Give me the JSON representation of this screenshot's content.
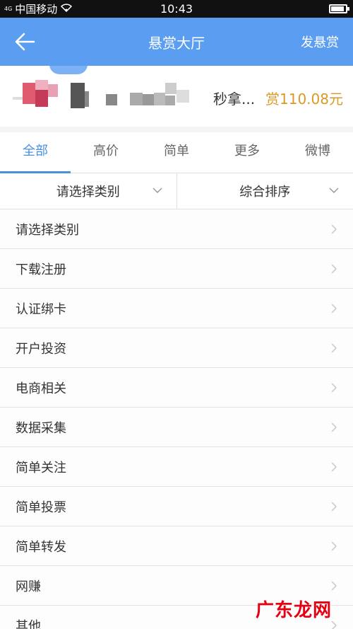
{
  "status_bar": {
    "signal": "4G",
    "carrier": "中国移动",
    "time": "10:43"
  },
  "appbar": {
    "title": "悬赏大厅",
    "action": "发悬赏"
  },
  "ticker": {
    "text": "秒拿...",
    "reward": "赏110.08元"
  },
  "tabs": [
    {
      "label": "全部",
      "active": true
    },
    {
      "label": "高价"
    },
    {
      "label": "简单"
    },
    {
      "label": "更多"
    },
    {
      "label": "微博"
    }
  ],
  "filters": {
    "category": "请选择类别",
    "sort": "综合排序"
  },
  "categories": [
    "请选择类别",
    "下载注册",
    "认证绑卡",
    "开户投资",
    "电商相关",
    "数据采集",
    "简单关注",
    "简单投票",
    "简单转发",
    "网赚",
    "其他"
  ],
  "watermark": "广东龙网",
  "colors": {
    "header": "#5b9df1",
    "accent": "#4a90e2",
    "reward": "#d99a24"
  }
}
